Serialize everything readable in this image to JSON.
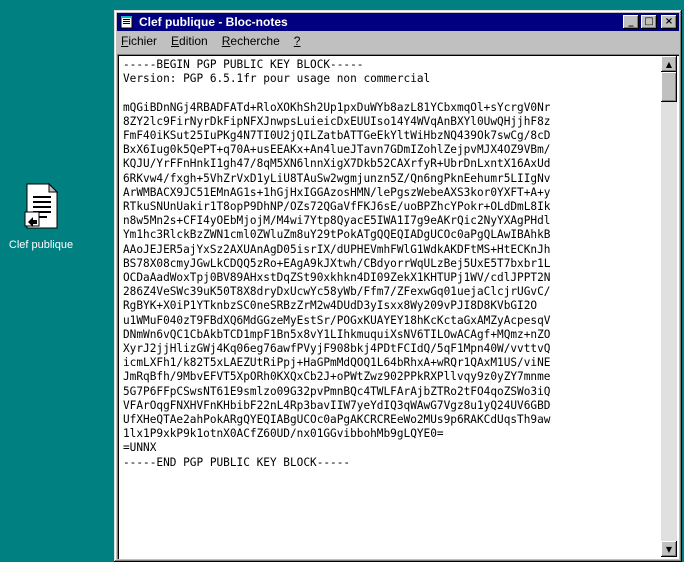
{
  "desktop": {
    "icon_label": "Clef publique"
  },
  "window": {
    "title": "Clef publique - Bloc-notes",
    "controls": {
      "minimize": "_",
      "maximize": "□",
      "close": "×"
    }
  },
  "menu": [
    {
      "label": "Fichier",
      "accel": "F",
      "rest": "ichier"
    },
    {
      "label": "Edition",
      "accel": "E",
      "rest": "dition"
    },
    {
      "label": "Recherche",
      "accel": "R",
      "rest": "echerche"
    },
    {
      "label": "?",
      "accel": "?",
      "rest": ""
    }
  ],
  "document": {
    "text": "-----BEGIN PGP PUBLIC KEY BLOCK-----\nVersion: PGP 6.5.1fr pour usage non commercial\n\nmQGiBDnNGj4RBADFATd+RloXOKhSh2Up1pxDuWYb8azL81YCbxmqOl+sYcrgV0Nr\n8ZY2lc9FirNyrDkFipNFXJnwpsLuieicDxEUUIso14Y4WVqAnBXYl0UwQHjjhF8z\nFmF40iKSut25IuPKg4N7TI0U2jQILZatbATTGeEkYltWiHbzNQ439Ok7swCg/8cD\nBxX6Iug0k5QePT+q70A+usEEAKx+An4lueJTavn7GDmIZohlZejpvMJX4OZ9VBm/\nKQJU/YrFFnHnkI1gh47/8qM5XN6lnnXigX7Dkb52CAXrfyR+UbrDnLxntX16AxUd\n6RKvw4/fxgh+5VhZrVxD1yLiU8TAuSw2wgmjunzn5Z/Qn6ngPknEehumr5LIIgNv\nArWMBACX9JC51EMnAG1s+1hGjHxIGGAzosHMN/lePgszWebeAXS3kor0YXFT+A+y\nRTkuSNUnUakir1T8opP9DhNP/OZs72QGaVfFKJ6sE/uoBPZhcYPokr+OLdDmL8Ik\nn8w5Mn2s+CFI4yOEbMjojM/M4wi7Ytp8QyacE5IWA1I7g9eAKrQic2NyYXAgPHdl\nYm1hc3RlckBzZWN1cml0ZWluZm8uY29tPokATgQQEQIADgUCOc0aPgQLAwIBAhkB\nAAoJEJER5ajYxSz2AXUAnAgD05isrIX/dUPHEVmhFWlG1WdkAKDFtMS+HtECKnJh\nBS78X08cmyJGwLkCDQQ5zRo+EAgA9kJXtwh/CBdyorrWqULzBej5UxE5T7bxbr1L\nOCDaAadWoxTpj0BV89AHxstDqZSt90xkhkn4DI09ZekX1KHTUPj1WV/cdlJPPT2N\n286Z4VeSWc39uK50T8X8dryDxUcwYc58yWb/Ffm7/ZFexwGq01uejaClcjrUGvC/\nRgBYK+X0iP1YTknbzSC0neSRBzZrM2w4DUdD3yIsxx8Wy209vPJI8D8KVbGI2O\nu1WMuF040zT9FBdXQ6MdGGzeMyEstSr/POGxKUAYEY18hKcKctaGxAMZyAcpesqV\nDNmWn6vQC1CbAkbTCD1mpF1Bn5x8vY1LIhkmuquiXsNV6TILOwACAgf+MQmz+nZO\nXyrJ2jjHlizGWj4Kq06eg76awfPVyjF908bkj4PDtFCIdQ/5qF1Mpn40W/vvttvQ\nicmLXFh1/k82T5xLAEZUtRiPpj+HaGPmMdQOQ1L64bRhxA+wRQr1QAxM1US/viNE\nJmRqBfh/9MbvEFVT5XpORh0KXQxCb2J+oPWtZwz902PPkRXPllvqy9z0yZY7mnme\n5G7P6FFpCSwsNT61E9smlzo09G32pvPmnBQc4TWLFArAjbZTRo2tFO4qoZSWo3iQ\nVFArOqgFNXHVFnKHbibF22nL4Rp3bavIIW7yeYdIQ3qWAwG7Vgz8u1yQ24UV6GBD\nUfXHeQTAe2ahPokARgQYEQIABgUCOc0aPgAKCRCREeWo2MUs9p6RAKCdUqsTh9aw\n1lx1P9xkP9k1otnX0ACfZ60UD/nx01GGvibbohMb9gLQYE0=\n=UNNX\n-----END PGP PUBLIC KEY BLOCK-----"
  },
  "scrollbar": {
    "up_arrow": "▲",
    "down_arrow": "▼"
  }
}
